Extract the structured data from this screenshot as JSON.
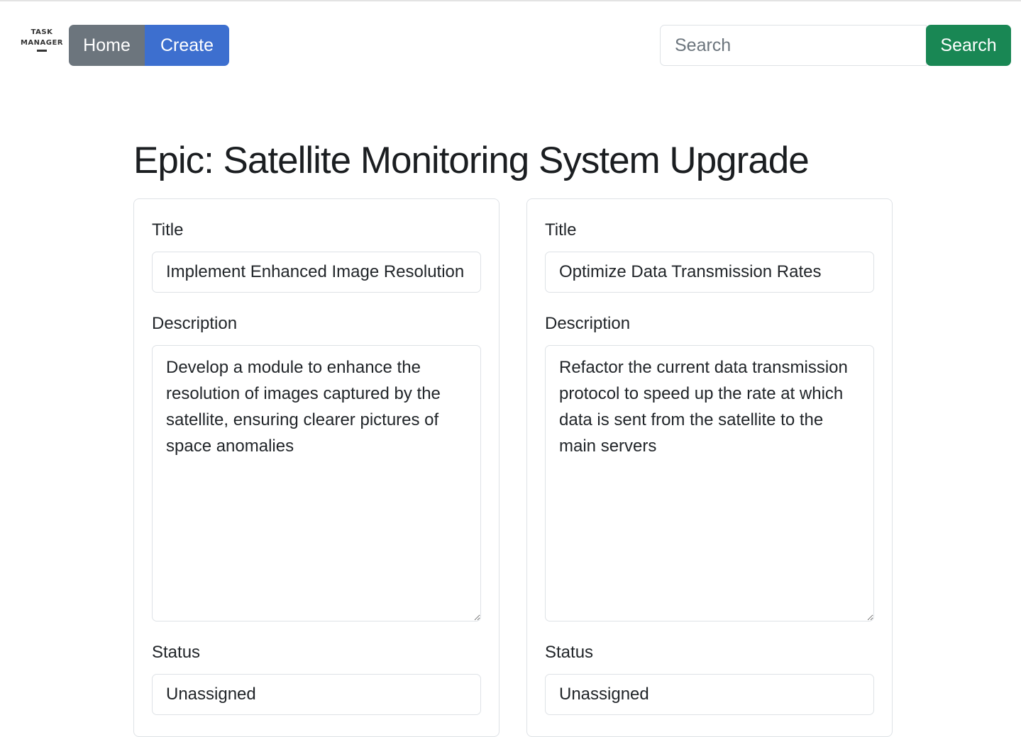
{
  "navbar": {
    "logo_line1": "TASK",
    "logo_line2": "MANAGER",
    "home_label": "Home",
    "create_label": "Create",
    "search_placeholder": "Search",
    "search_button_label": "Search"
  },
  "page": {
    "title": "Epic: Satellite Monitoring System Upgrade"
  },
  "cards": [
    {
      "title_label": "Title",
      "title_value": "Implement Enhanced Image Resolution",
      "description_label": "Description",
      "description_value": "Develop a module to enhance the resolution of images captured by the satellite, ensuring clearer pictures of space anomalies",
      "status_label": "Status",
      "status_value": "Unassigned"
    },
    {
      "title_label": "Title",
      "title_value": "Optimize Data Transmission Rates",
      "description_label": "Description",
      "description_value": "Refactor the current data transmission protocol to speed up the rate at which data is sent from the satellite to the main servers",
      "status_label": "Status",
      "status_value": "Unassigned"
    }
  ],
  "colors": {
    "home_button": "#6c757d",
    "create_button": "#3d6fcf",
    "search_button": "#198754"
  }
}
